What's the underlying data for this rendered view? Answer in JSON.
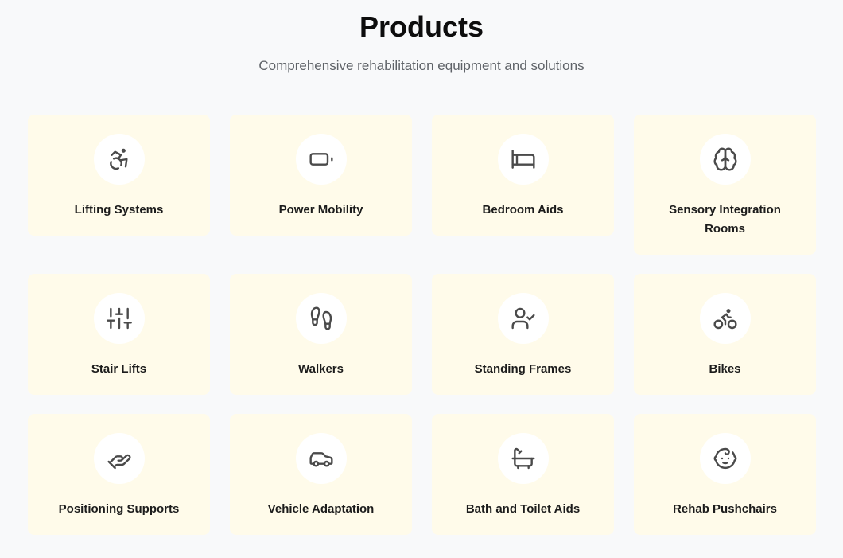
{
  "header": {
    "title": "Products",
    "subtitle": "Comprehensive rehabilitation equipment and solutions"
  },
  "products": [
    {
      "label": "Lifting Systems",
      "icon": "accessibility-icon"
    },
    {
      "label": "Power Mobility",
      "icon": "battery-icon"
    },
    {
      "label": "Bedroom Aids",
      "icon": "bed-icon"
    },
    {
      "label": "Sensory Integration Rooms",
      "icon": "brain-icon"
    },
    {
      "label": "Stair Lifts",
      "icon": "sliders-icon"
    },
    {
      "label": "Walkers",
      "icon": "footprints-icon"
    },
    {
      "label": "Standing Frames",
      "icon": "user-check-icon"
    },
    {
      "label": "Bikes",
      "icon": "bike-icon"
    },
    {
      "label": "Positioning Supports",
      "icon": "hand-holding-icon"
    },
    {
      "label": "Vehicle Adaptation",
      "icon": "car-icon"
    },
    {
      "label": "Bath and Toilet Aids",
      "icon": "bath-icon"
    },
    {
      "label": "Rehab Pushchairs",
      "icon": "baby-icon"
    }
  ],
  "colors": {
    "background": "#f8f9fa",
    "card": "#fffbea",
    "icon_circle": "#ffffff",
    "icon_stroke": "#4a4a4a"
  }
}
